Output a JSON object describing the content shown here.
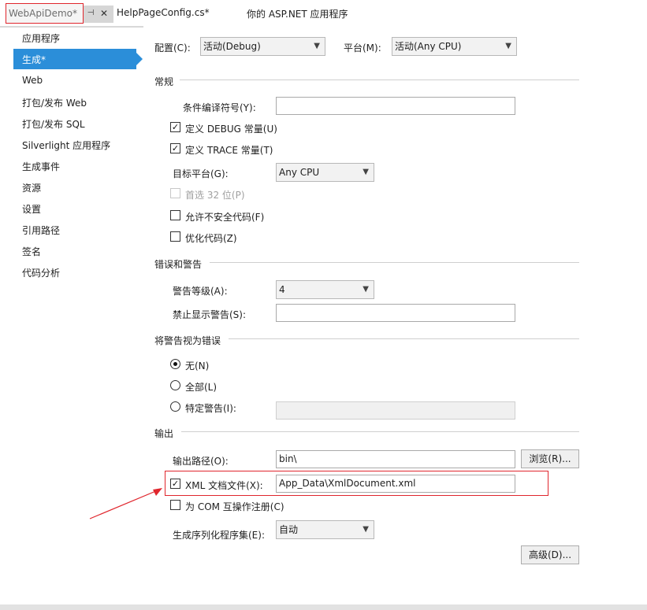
{
  "tabs": {
    "active": "WebApiDemo*",
    "second": "HelpPageConfig.cs*",
    "third": "你的 ASP.NET 应用程序"
  },
  "sidebar": {
    "items": [
      {
        "label": "应用程序"
      },
      {
        "label": "生成*"
      },
      {
        "label": "Web"
      },
      {
        "label": "打包/发布 Web"
      },
      {
        "label": "打包/发布 SQL"
      },
      {
        "label": "Silverlight 应用程序"
      },
      {
        "label": "生成事件"
      },
      {
        "label": "资源"
      },
      {
        "label": "设置"
      },
      {
        "label": "引用路径"
      },
      {
        "label": "签名"
      },
      {
        "label": "代码分析"
      }
    ],
    "selected": "生成*"
  },
  "config": {
    "config_label": "配置(C):",
    "config_value": "活动(Debug)",
    "platform_label": "平台(M):",
    "platform_value": "活动(Any CPU)"
  },
  "general": {
    "title": "常规",
    "cond_symbols_label": "条件编译符号(Y):",
    "cond_symbols_value": "",
    "define_debug": {
      "label": "定义 DEBUG 常量(U)",
      "checked": true
    },
    "define_trace": {
      "label": "定义 TRACE 常量(T)",
      "checked": true
    },
    "target_platform_label": "目标平台(G):",
    "target_platform_value": "Any CPU",
    "prefer32": {
      "label": "首选 32 位(P)",
      "checked": false,
      "disabled": true
    },
    "unsafe": {
      "label": "允许不安全代码(F)",
      "checked": false
    },
    "optimize": {
      "label": "优化代码(Z)",
      "checked": false
    }
  },
  "errors": {
    "title": "错误和警告",
    "warning_level_label": "警告等级(A):",
    "warning_level_value": "4",
    "suppress_label": "禁止显示警告(S):",
    "suppress_value": ""
  },
  "treat_warnings": {
    "title": "将警告视为错误",
    "none": {
      "label": "无(N)",
      "selected": true
    },
    "all": {
      "label": "全部(L)",
      "selected": false
    },
    "specific": {
      "label": "特定警告(I):",
      "selected": false
    },
    "specific_value": ""
  },
  "output": {
    "title": "输出",
    "path_label": "输出路径(O):",
    "path_value": "bin\\",
    "browse_label": "浏览(R)...",
    "xml_doc": {
      "label": "XML 文档文件(X):",
      "checked": true
    },
    "xml_doc_value": "App_Data\\XmlDocument.xml",
    "com_interop": {
      "label": "为 COM 互操作注册(C)",
      "checked": false
    },
    "serialization_label": "生成序列化程序集(E):",
    "serialization_value": "自动",
    "advanced_label": "高级(D)..."
  },
  "colors": {
    "accent": "#2b8ed9",
    "annotation": "#e0262d"
  },
  "icons": {
    "pin": "pin-icon",
    "close": "close-icon",
    "dropdown": "chevron-down-icon",
    "check": "check-icon"
  }
}
